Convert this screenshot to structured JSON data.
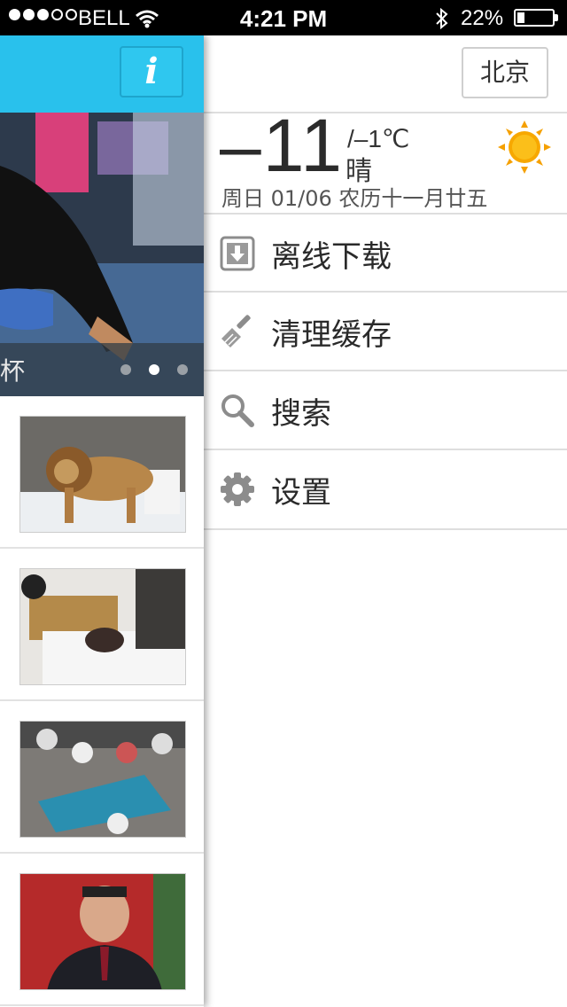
{
  "status_bar": {
    "carrier": "BELL",
    "time": "4:21 PM",
    "battery_percent": "22%",
    "battery_level": 0.22,
    "signal_bars_filled": 3,
    "signal_bars_total": 5
  },
  "news": {
    "info_button_label": "i",
    "hero_caption": "杯",
    "pager": {
      "count": 3,
      "active_index": 1
    },
    "thumbnails": [
      "lion-in-snow-photo",
      "person-in-bed-photo",
      "crowd-with-stretcher-photo",
      "official-portrait-photo"
    ]
  },
  "weather": {
    "city": "北京",
    "temp_high": "–11",
    "temp_low": "/–1℃",
    "condition": "晴",
    "date_line": "周日  01/06  农历十一月廿五",
    "icon": "sun-icon"
  },
  "menu": {
    "offline_download": "离线下载",
    "clear_cache": "清理缓存",
    "search": "搜索",
    "settings": "设置"
  },
  "colors": {
    "header_blue": "#29c1ec",
    "sun_orange": "#f5a000",
    "icon_gray": "#8c8c8c"
  }
}
